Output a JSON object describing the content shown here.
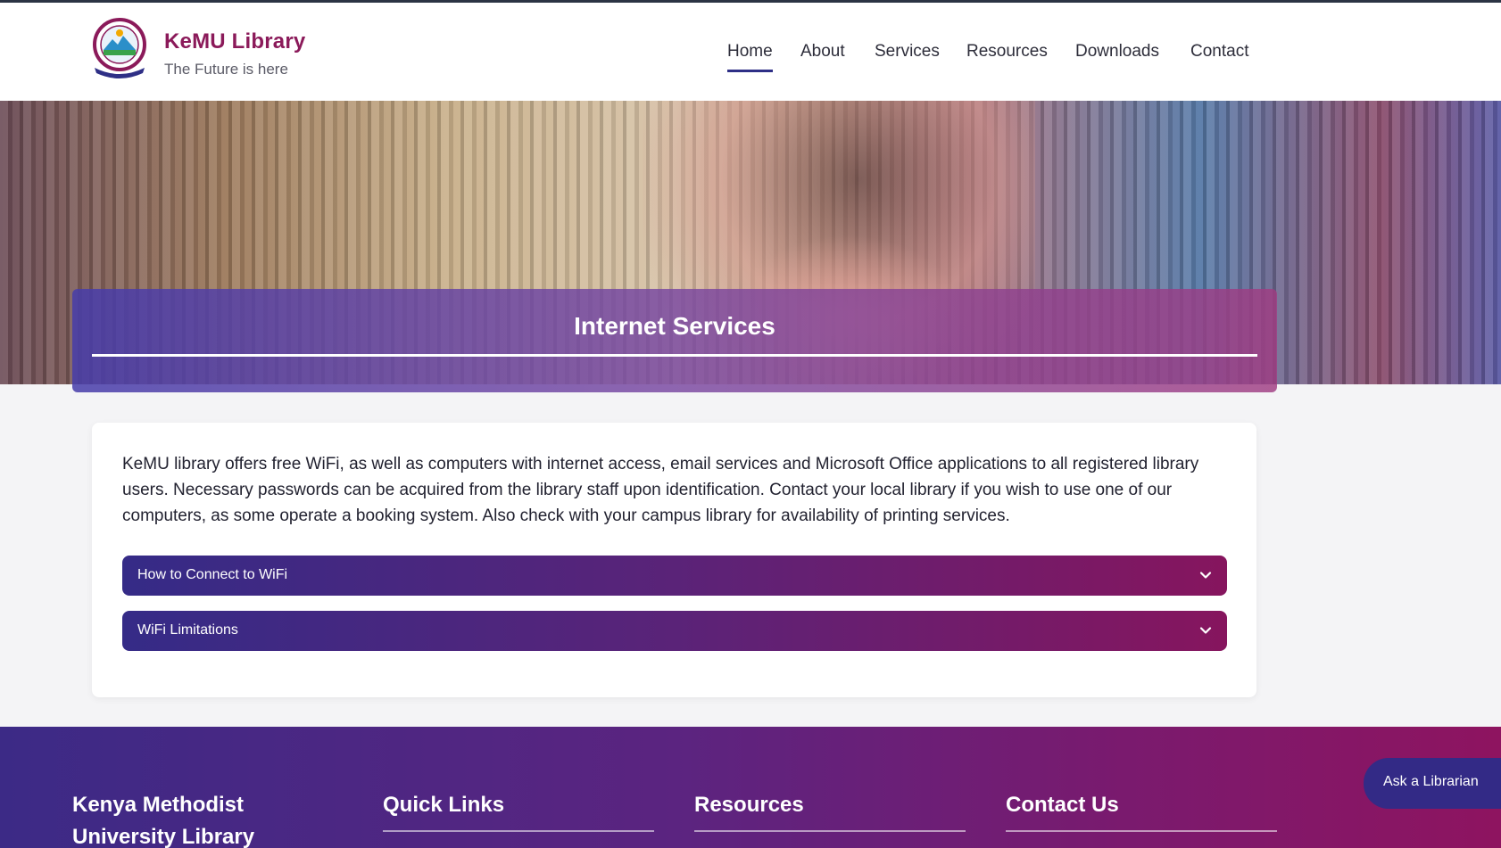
{
  "header": {
    "brand_title": "KeMU Library",
    "brand_subtitle": "The Future is here",
    "logo_icon": "kemu-crest-logo"
  },
  "nav": {
    "items": [
      {
        "label": "Home",
        "active": true
      },
      {
        "label": "About",
        "active": false
      },
      {
        "label": "Services",
        "active": false
      },
      {
        "label": "Resources",
        "active": false
      },
      {
        "label": "Downloads",
        "active": false
      },
      {
        "label": "Contact",
        "active": false
      }
    ]
  },
  "hero": {
    "title": "Internet Services"
  },
  "content": {
    "intro": "KeMU library offers free WiFi, as well as computers with internet access, email services and Microsoft Office applications to all registered library users. Necessary passwords can be acquired from the library staff upon identification. Contact your local library if you wish to use one of our computers, as some operate a booking system. Also check with your campus library for availability of printing services.",
    "accordions": [
      {
        "label": "How to Connect to WiFi",
        "icon": "chevron-down-icon"
      },
      {
        "label": "WiFi Limitations",
        "icon": "chevron-down-icon"
      }
    ]
  },
  "footer": {
    "about_title_line1": "Kenya Methodist",
    "about_title_line2": "University Library",
    "quick_links_title": "Quick Links",
    "resources_title": "Resources",
    "contact_title": "Contact Us"
  },
  "ask_librarian": {
    "label": "Ask a Librarian"
  },
  "colors": {
    "brand": "#8b1a5a",
    "nav_active": "#2e2f86",
    "accent_start": "#352b87",
    "accent_end": "#86155e"
  }
}
